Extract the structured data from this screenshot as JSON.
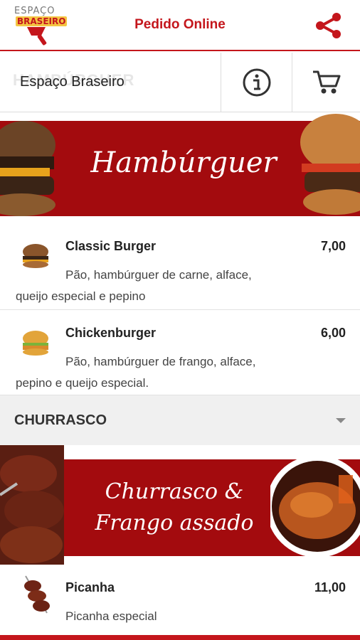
{
  "header": {
    "logo_line1": "ESPAÇO",
    "logo_line2": "BRASEIRO",
    "title": "Pedido Online",
    "share_icon": "share-icon",
    "accent_color": "#c4161c"
  },
  "restaurant": {
    "ghost_text": "HAMBÚRGUER",
    "name": "Espaço Braseiro",
    "info_icon": "info-icon",
    "cart_icon": "cart-icon"
  },
  "banners": {
    "burger": "Hambúrguer",
    "churrasco_line1": "Churrasco &",
    "churrasco_line2": "Frango assado",
    "banner_color": "#a30b0e"
  },
  "items": [
    {
      "name": "Classic Burger",
      "price": "7,00",
      "description": "Pão, hambúrguer de carne, alface, queijo especial e pepino"
    },
    {
      "name": "Chickenburger",
      "price": "6,00",
      "description": "Pão, hambúrguer de frango, alface, pepino e queijo especial."
    },
    {
      "name": "Picanha",
      "price": "11,00",
      "description": "Picanha especial"
    }
  ],
  "section": {
    "label": "CHURRASCO"
  }
}
